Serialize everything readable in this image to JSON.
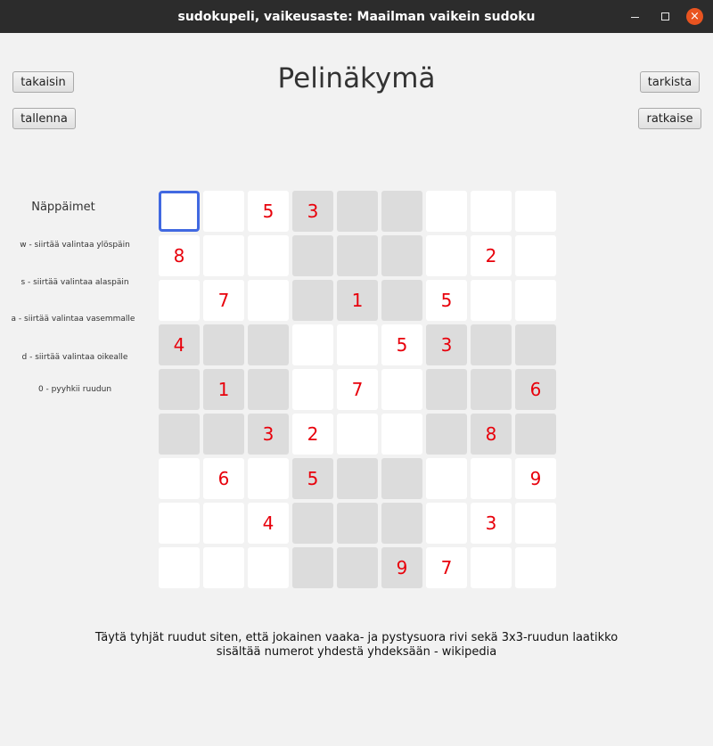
{
  "window": {
    "title": "sudokupeli, vaikeusaste: Maailman vaikein sudoku",
    "close_glyph": "×"
  },
  "buttons": {
    "back": "takaisin",
    "save": "tallenna",
    "check": "tarkista",
    "solve": "ratkaise"
  },
  "heading": "Pelinäkymä",
  "keys": {
    "title": "Näppäimet",
    "lines": [
      "w - siirtää valintaa ylöspäin",
      "s - siirtää valintaa alaspäin",
      "a - siirtää valintaa vasemmalle",
      "d - siirtää valintaa oikealle",
      "0 - pyyhkii ruudun"
    ]
  },
  "board": {
    "selected": [
      0,
      0
    ],
    "selection_color": "#4169e1",
    "digit_color": "#e8000b",
    "rows": [
      [
        "",
        "",
        "5",
        "3",
        "",
        "",
        "",
        "",
        ""
      ],
      [
        "8",
        "",
        "",
        "",
        "",
        "",
        "",
        "2",
        ""
      ],
      [
        "",
        "7",
        "",
        "",
        "1",
        "",
        "5",
        "",
        ""
      ],
      [
        "4",
        "",
        "",
        "",
        "",
        "5",
        "3",
        "",
        ""
      ],
      [
        "",
        "1",
        "",
        "",
        "7",
        "",
        "",
        "",
        "6"
      ],
      [
        "",
        "",
        "3",
        "2",
        "",
        "",
        "",
        "8",
        ""
      ],
      [
        "",
        "6",
        "",
        "5",
        "",
        "",
        "",
        "",
        "9"
      ],
      [
        "",
        "",
        "4",
        "",
        "",
        "",
        "",
        "3",
        ""
      ],
      [
        "",
        "",
        "",
        "",
        "",
        "9",
        "7",
        "",
        ""
      ]
    ]
  },
  "instructions": [
    "Täytä tyhjät ruudut siten, että jokainen vaaka- ja pystysuora rivi sekä 3x3-ruudun laatikko",
    "sisältää numerot yhdestä yhdeksään - wikipedia"
  ]
}
